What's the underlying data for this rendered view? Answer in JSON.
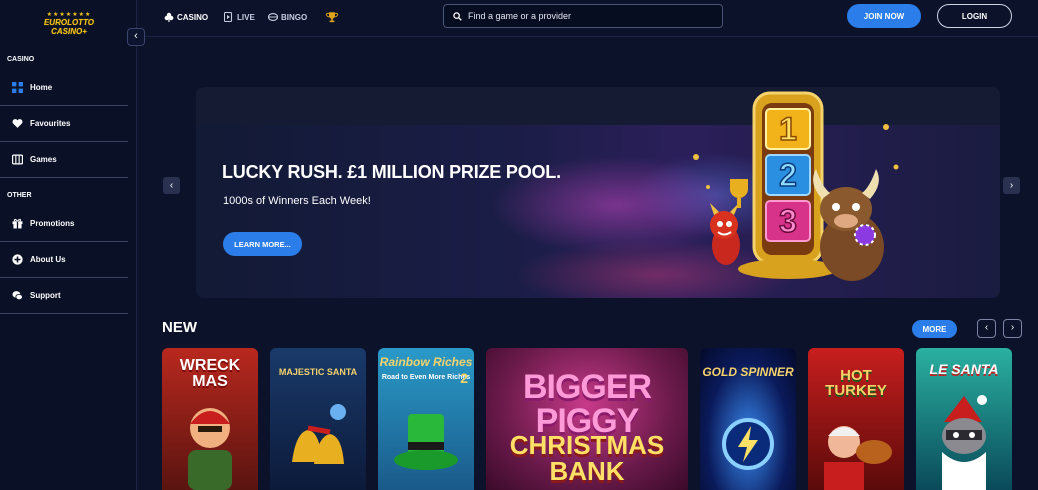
{
  "brand": {
    "logo_line1": "EUROLOTTO",
    "logo_line2": "CASINO+",
    "accent": "#2b7de9",
    "background": "#0b1229"
  },
  "sidebar": {
    "collapse_icon": "chevron-left-icon",
    "sections": [
      {
        "label": "CASINO"
      },
      {
        "label": "OTHER"
      }
    ],
    "items": [
      {
        "label": "Home",
        "icon": "grid-icon"
      },
      {
        "label": "Favourites",
        "icon": "heart-icon"
      },
      {
        "label": "Games",
        "icon": "games-icon"
      },
      {
        "label": "Promotions",
        "icon": "gift-icon"
      },
      {
        "label": "About Us",
        "icon": "plus-circle-icon"
      },
      {
        "label": "Support",
        "icon": "chat-icon"
      }
    ]
  },
  "topnav": {
    "tabs": [
      {
        "label": "CASINO",
        "icon": "clubs-icon"
      },
      {
        "label": "LIVE",
        "icon": "live-icon"
      },
      {
        "label": "BINGO",
        "icon": "bingo-icon"
      },
      {
        "label": "",
        "icon": "trophy-icon"
      }
    ],
    "search": {
      "placeholder": "Find a game or a provider",
      "value": ""
    },
    "join_label": "JOIN NOW",
    "login_label": "LOGIN"
  },
  "banner": {
    "title": "LUCKY RUSH. £1 MILLION PRIZE POOL.",
    "subtitle": "1000s of Winners Each Week!",
    "cta_label": "LEARN MORE...",
    "slot_numbers": [
      "1",
      "2",
      "3"
    ]
  },
  "new_section": {
    "title": "NEW",
    "more_label": "MORE",
    "games": [
      {
        "title": "WRECK MAS"
      },
      {
        "title": "MAJESTIC SANTA"
      },
      {
        "title": "Rainbow Riches",
        "subtitle": "Road to Even More Riches",
        "badge": "2"
      },
      {
        "title": "BIGGER PIGGY",
        "subtitle": "CHRISTMAS BANK"
      },
      {
        "title": "GOLD SPINNER"
      },
      {
        "title": "HOT TURKEY"
      },
      {
        "title": "LE SANTA"
      }
    ]
  }
}
